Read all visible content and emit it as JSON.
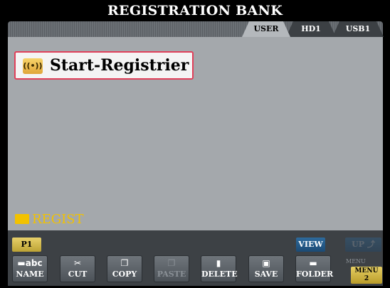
{
  "header": {
    "title": "REGISTRATION BANK"
  },
  "tabs": [
    {
      "label": "USER",
      "active": true
    },
    {
      "label": "HD1",
      "active": false
    },
    {
      "label": "USB1",
      "active": false
    }
  ],
  "file_list": {
    "items": [
      {
        "label": "Start-Registrier",
        "icon": "registration-bank-icon",
        "icon_glyph": "((•))",
        "selected": true
      }
    ],
    "current_folder": "REGIST"
  },
  "controls": {
    "page": "P1",
    "view": "VIEW",
    "up": "UP"
  },
  "function_buttons": [
    {
      "label": "NAME",
      "icon_glyph": "▬abc",
      "enabled": true
    },
    {
      "label": "CUT",
      "icon_glyph": "✂",
      "enabled": true
    },
    {
      "label": "COPY",
      "icon_glyph": "❐",
      "enabled": true
    },
    {
      "label": "PASTE",
      "icon_glyph": "❐",
      "enabled": false
    },
    {
      "label": "DELETE",
      "icon_glyph": "▮",
      "enabled": true
    },
    {
      "label": "SAVE",
      "icon_glyph": "▣",
      "enabled": true
    },
    {
      "label": "FOLDER",
      "icon_glyph": "▬",
      "enabled": true
    }
  ],
  "menu": {
    "ghost_label": "MENU",
    "label": "MENU",
    "number": "2"
  },
  "colors": {
    "selection_border": "#e0405a",
    "folder_yellow": "#f2c200",
    "accent_blue": "#2d6a9c",
    "panel_gray": "#a4a8ac"
  }
}
